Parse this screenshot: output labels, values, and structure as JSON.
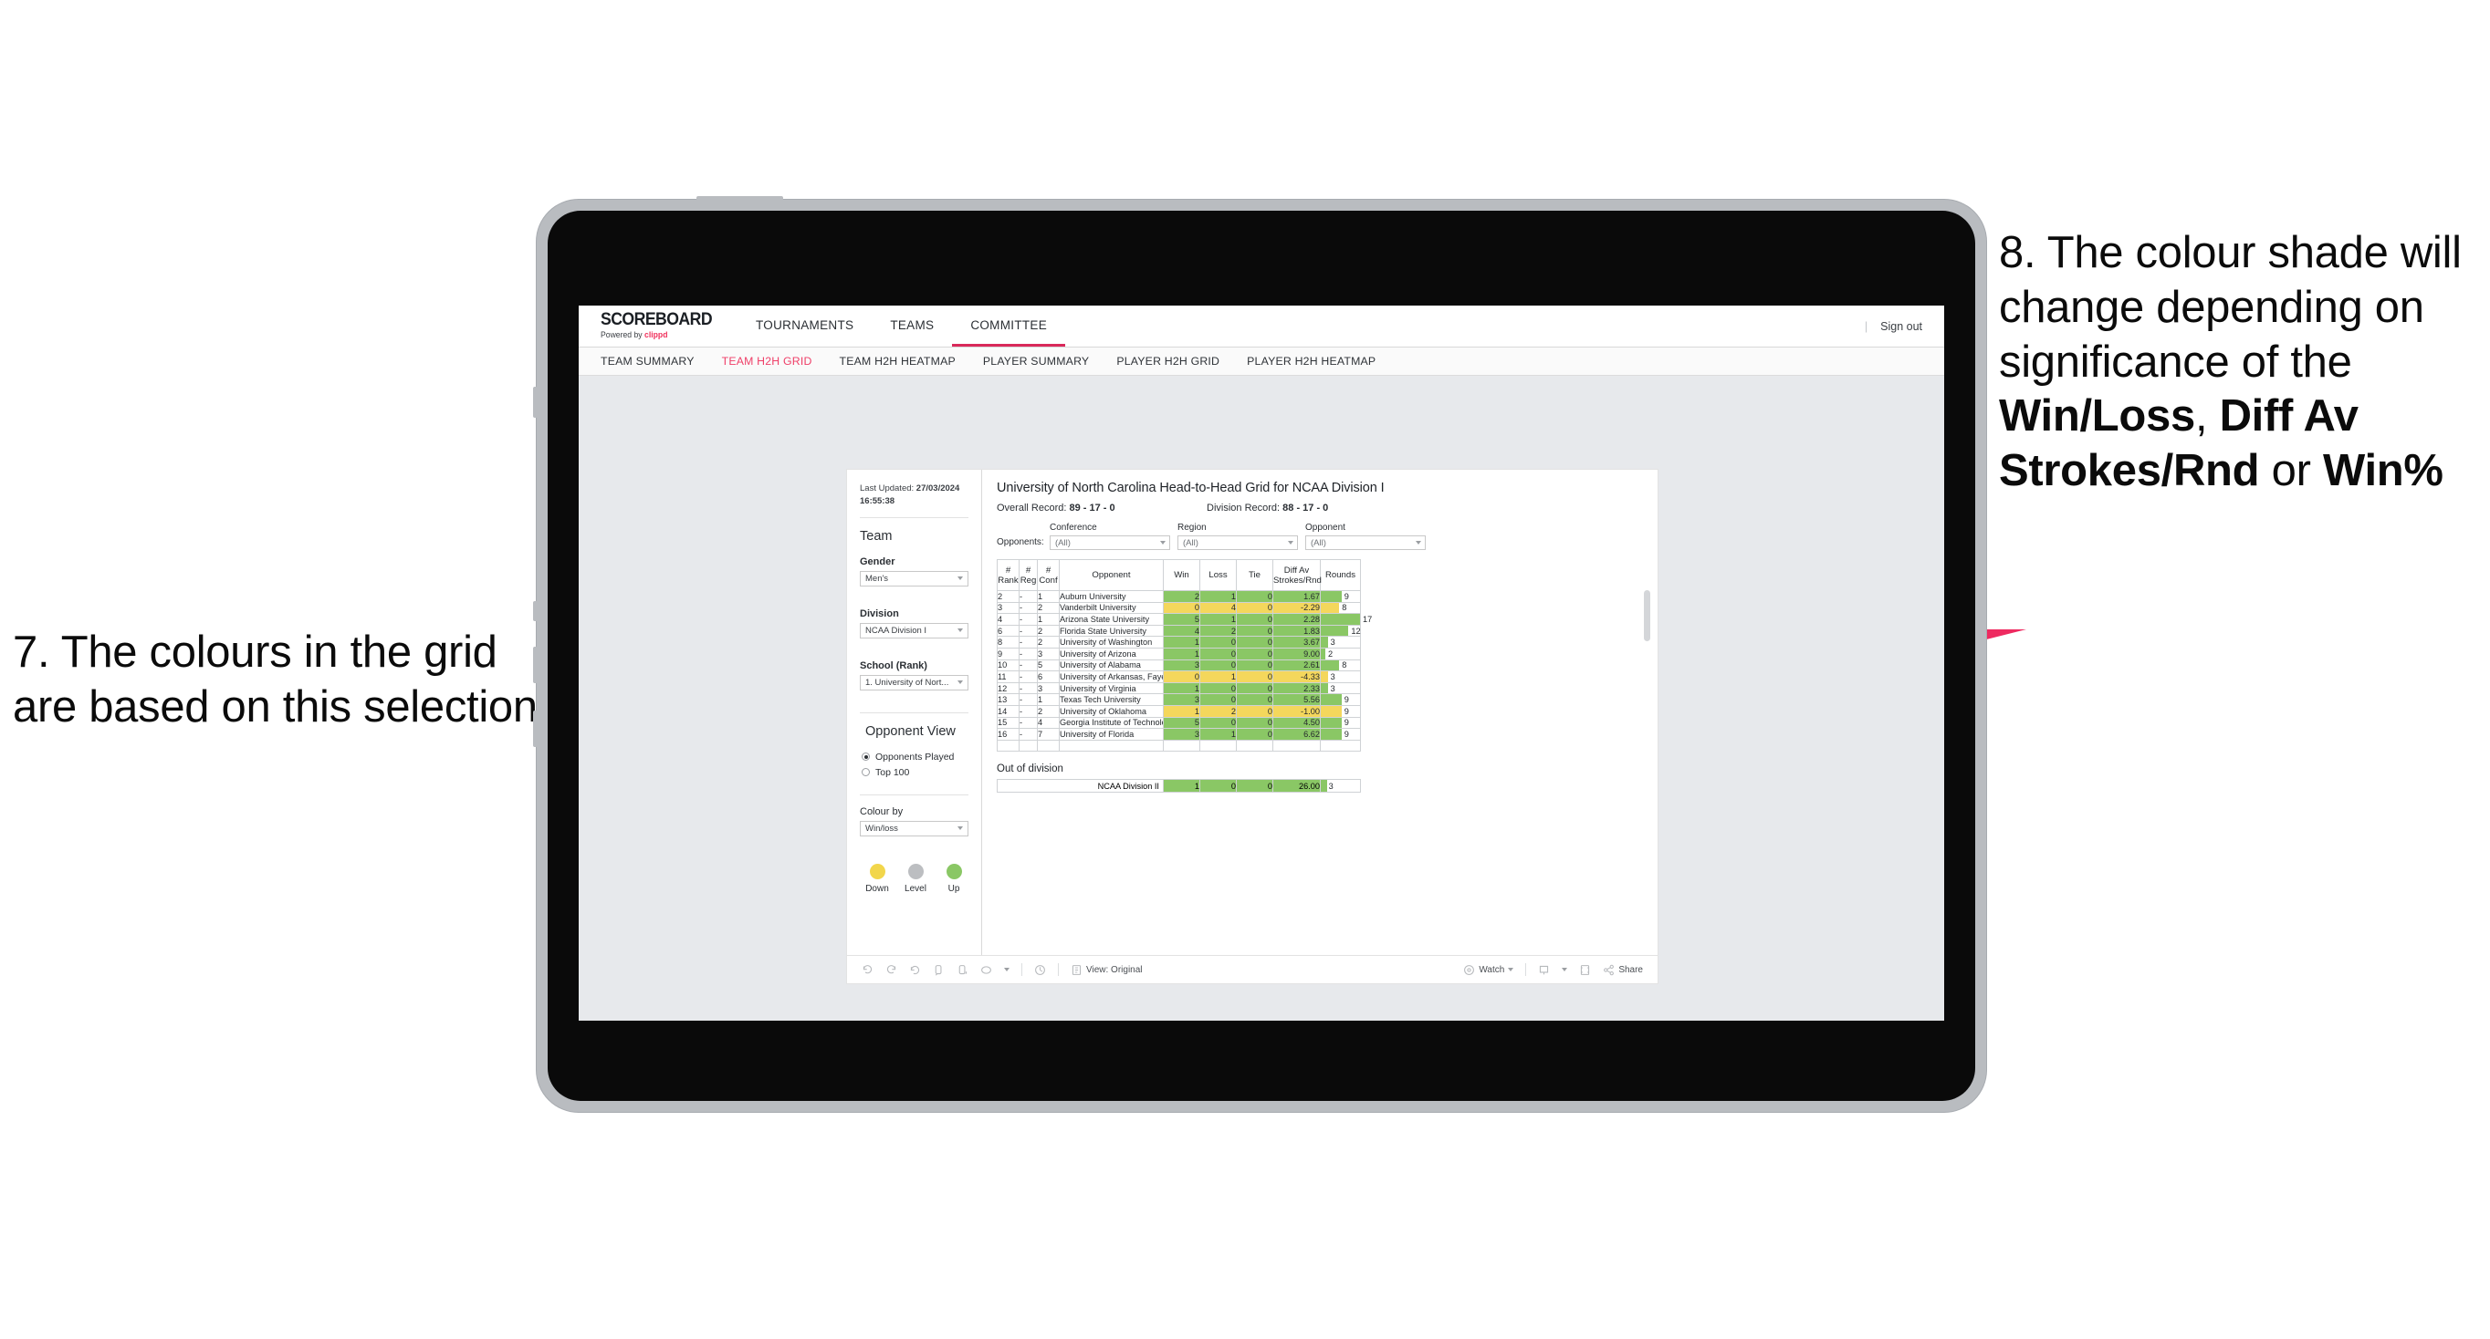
{
  "annotations": {
    "left": {
      "number": "7.",
      "text": "7. The colours in the grid are based on this selection"
    },
    "right_prefix": "8. The colour shade will change depending on significance of the ",
    "right_bold1": "Win/Loss",
    "right_mid1": ", ",
    "right_bold2": "Diff Av Strokes/Rnd",
    "right_mid2": " or ",
    "right_bold3": "Win%",
    "arrow_color": "#ee2a60"
  },
  "app": {
    "logo_main": "SCOREBOARD",
    "logo_sub_prefix": "Powered by ",
    "logo_sub_brand": "clippd",
    "top_nav": [
      {
        "label": "TOURNAMENTS",
        "active": false
      },
      {
        "label": "TEAMS",
        "active": false
      },
      {
        "label": "COMMITTEE",
        "active": true
      }
    ],
    "sign_out": "Sign out",
    "sub_nav": [
      {
        "label": "TEAM SUMMARY",
        "active": false
      },
      {
        "label": "TEAM H2H GRID",
        "active": true
      },
      {
        "label": "TEAM H2H HEATMAP",
        "active": false
      },
      {
        "label": "PLAYER SUMMARY",
        "active": false
      },
      {
        "label": "PLAYER H2H GRID",
        "active": false
      },
      {
        "label": "PLAYER H2H HEATMAP",
        "active": false
      }
    ]
  },
  "sidebar": {
    "last_updated_label": "Last Updated:",
    "last_updated_value": "27/03/2024 16:55:38",
    "team_heading": "Team",
    "gender_label": "Gender",
    "gender_value": "Men's",
    "division_label": "Division",
    "division_value": "NCAA Division I",
    "school_label": "School (Rank)",
    "school_value": "1. University of Nort...",
    "opponent_view_heading": "Opponent View",
    "radio_options": [
      {
        "label": "Opponents Played",
        "selected": true
      },
      {
        "label": "Top 100",
        "selected": false
      }
    ],
    "colour_by_label": "Colour by",
    "colour_by_value": "Win/loss",
    "legend": [
      {
        "label": "Down",
        "color": "#f2d64b"
      },
      {
        "label": "Level",
        "color": "#bcbec1"
      },
      {
        "label": "Up",
        "color": "#8ac765"
      }
    ]
  },
  "viz": {
    "title": "University of North Carolina Head-to-Head Grid for NCAA Division I",
    "overall_label": "Overall Record:",
    "overall_value": "89 - 17 - 0",
    "division_label": "Division Record:",
    "division_value": "88 - 17 - 0",
    "opponents_label": "Opponents:",
    "filters": [
      {
        "caption": "Conference",
        "value": "(All)"
      },
      {
        "caption": "Region",
        "value": "(All)"
      },
      {
        "caption": "Opponent",
        "value": "(All)"
      }
    ],
    "out_of_division_title": "Out of division",
    "out_of_division_row": {
      "name": "NCAA Division II",
      "win": "1",
      "loss": "0",
      "tie": "0",
      "diff": "26.00",
      "rounds": "3",
      "rounds_pct": 17,
      "color": "#8ac765"
    },
    "toolbar": {
      "view_label": "View: Original",
      "watch_label": "Watch",
      "share_label": "Share"
    }
  },
  "chart_data": {
    "type": "table",
    "title": "University of North Carolina Head-to-Head Grid for NCAA Division I",
    "columns": [
      "# Rank",
      "# Reg",
      "# Conf",
      "Opponent",
      "Win",
      "Loss",
      "Tie",
      "Diff Av Strokes/Rnd",
      "Rounds"
    ],
    "column_headers_multiline": [
      [
        "#",
        "Rank"
      ],
      [
        "#",
        "Reg"
      ],
      [
        "#",
        "Conf"
      ],
      [
        "Opponent"
      ],
      [
        "Win"
      ],
      [
        "Loss"
      ],
      [
        "Tie"
      ],
      [
        "Diff Av",
        "Strokes/Rnd"
      ],
      [
        "Rounds"
      ]
    ],
    "colour_by": "Win/loss",
    "colors": {
      "up": "#8ac765",
      "down": "#f4d75c",
      "level": "#bcbec1"
    },
    "rounds_max": 17,
    "rows": [
      {
        "rank": "2",
        "reg": "-",
        "conf": "1",
        "opponent": "Auburn University",
        "win": "2",
        "loss": "1",
        "tie": "0",
        "diff": "1.67",
        "rounds": "9",
        "state": "up"
      },
      {
        "rank": "3",
        "reg": "-",
        "conf": "2",
        "opponent": "Vanderbilt University",
        "win": "0",
        "loss": "4",
        "tie": "0",
        "diff": "-2.29",
        "rounds": "8",
        "state": "down"
      },
      {
        "rank": "4",
        "reg": "-",
        "conf": "1",
        "opponent": "Arizona State University",
        "win": "5",
        "loss": "1",
        "tie": "0",
        "diff": "2.28",
        "rounds": "17",
        "state": "up"
      },
      {
        "rank": "6",
        "reg": "-",
        "conf": "2",
        "opponent": "Florida State University",
        "win": "4",
        "loss": "2",
        "tie": "0",
        "diff": "1.83",
        "rounds": "12",
        "state": "up"
      },
      {
        "rank": "8",
        "reg": "-",
        "conf": "2",
        "opponent": "University of Washington",
        "win": "1",
        "loss": "0",
        "tie": "0",
        "diff": "3.67",
        "rounds": "3",
        "state": "up"
      },
      {
        "rank": "9",
        "reg": "-",
        "conf": "3",
        "opponent": "University of Arizona",
        "win": "1",
        "loss": "0",
        "tie": "0",
        "diff": "9.00",
        "rounds": "2",
        "state": "up"
      },
      {
        "rank": "10",
        "reg": "-",
        "conf": "5",
        "opponent": "University of Alabama",
        "win": "3",
        "loss": "0",
        "tie": "0",
        "diff": "2.61",
        "rounds": "8",
        "state": "up"
      },
      {
        "rank": "11",
        "reg": "-",
        "conf": "6",
        "opponent": "University of Arkansas, Fayetteville",
        "win": "0",
        "loss": "1",
        "tie": "0",
        "diff": "-4.33",
        "rounds": "3",
        "state": "down"
      },
      {
        "rank": "12",
        "reg": "-",
        "conf": "3",
        "opponent": "University of Virginia",
        "win": "1",
        "loss": "0",
        "tie": "0",
        "diff": "2.33",
        "rounds": "3",
        "state": "up"
      },
      {
        "rank": "13",
        "reg": "-",
        "conf": "1",
        "opponent": "Texas Tech University",
        "win": "3",
        "loss": "0",
        "tie": "0",
        "diff": "5.56",
        "rounds": "9",
        "state": "up"
      },
      {
        "rank": "14",
        "reg": "-",
        "conf": "2",
        "opponent": "University of Oklahoma",
        "win": "1",
        "loss": "2",
        "tie": "0",
        "diff": "-1.00",
        "rounds": "9",
        "state": "down"
      },
      {
        "rank": "15",
        "reg": "-",
        "conf": "4",
        "opponent": "Georgia Institute of Technology",
        "win": "5",
        "loss": "0",
        "tie": "0",
        "diff": "4.50",
        "rounds": "9",
        "state": "up"
      },
      {
        "rank": "16",
        "reg": "-",
        "conf": "7",
        "opponent": "University of Florida",
        "win": "3",
        "loss": "1",
        "tie": "0",
        "diff": "6.62",
        "rounds": "9",
        "state": "up"
      }
    ]
  }
}
